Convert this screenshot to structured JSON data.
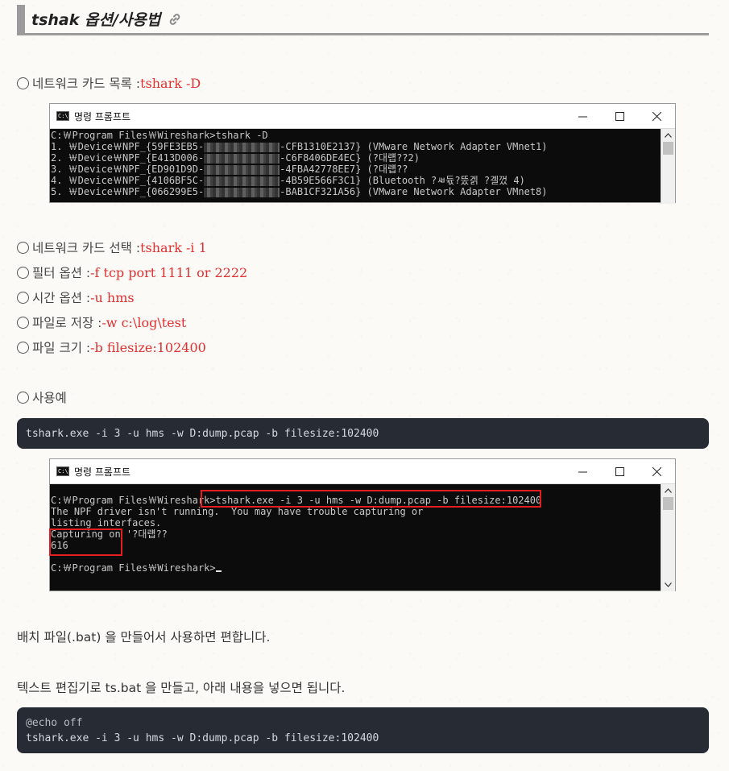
{
  "heading": {
    "title": "tshak 옵션/사용법"
  },
  "list1": [
    {
      "label": "네트워크 카드 목록 : ",
      "command": "tshark -D"
    }
  ],
  "console1": {
    "title": "명령 프롬프트",
    "prompt": "C:￦Program Files￦Wireshark>tshark -D",
    "lines": [
      {
        "prefix": "1. ￦Device￦NPF_{59FE3EB5-",
        "suffix": "-CFB1310E2137} (VMware Network Adapter VMnet1)"
      },
      {
        "prefix": "2. ￦Device￦NPF_{E413D006-",
        "suffix": "-C6F8406DE4EC} (?대럡??2)"
      },
      {
        "prefix": "3. ￦Device￦NPF_{ED901D9D-",
        "suffix": "-4FBA42778EE7} (?대럡??"
      },
      {
        "prefix": "4. ￦Device￦NPF_{4106BF5C-",
        "suffix": "-4B59E566F3C1} (Bluetooth ?ㅽ듃?뚰겕 ?곌껐 4)"
      },
      {
        "prefix": "5. ￦Device￦NPF_{066299E5-",
        "suffix": "-BAB1CF321A56} (VMware Network Adapter VMnet8)"
      }
    ]
  },
  "options": [
    {
      "label": "네트워크 카드 선택 : ",
      "command": "tshark -i 1"
    },
    {
      "label": "필터 옵션 : ",
      "command": "-f tcp port 1111 or 2222"
    },
    {
      "label": "시간 옵션 : ",
      "command": "-u hms"
    },
    {
      "label": "파일로 저장 : ",
      "command": "-w c:\\log\\test"
    },
    {
      "label": "파일 크기 : ",
      "command": "-b filesize:102400"
    }
  ],
  "example_label": "사용예",
  "code1": "tshark.exe -i 3 -u hms -w D:dump.pcap -b filesize:102400",
  "console2": {
    "title": "명령 프롬프트",
    "lines": [
      "C:￦Program Files￦Wireshark>tshark.exe -i 3 -u hms -w D:dump.pcap -b filesize:102400",
      "The NPF driver isn't running.  You may have trouble capturing or",
      "listing interfaces.",
      "Capturing on '?대럡??",
      "616",
      "",
      "C:￦Program Files￦Wireshark>"
    ]
  },
  "para1": "배치 파일(.bat) 을 만들어서 사용하면 편합니다.",
  "para2": "텍스트 편집기로 ts.bat 을 만들고, 아래 내용을 넣으면 됩니다.",
  "code2": {
    "line1": "@echo off",
    "line2": "tshark.exe -i 3 -u hms -w D:dump.pcap -b filesize:102400"
  }
}
